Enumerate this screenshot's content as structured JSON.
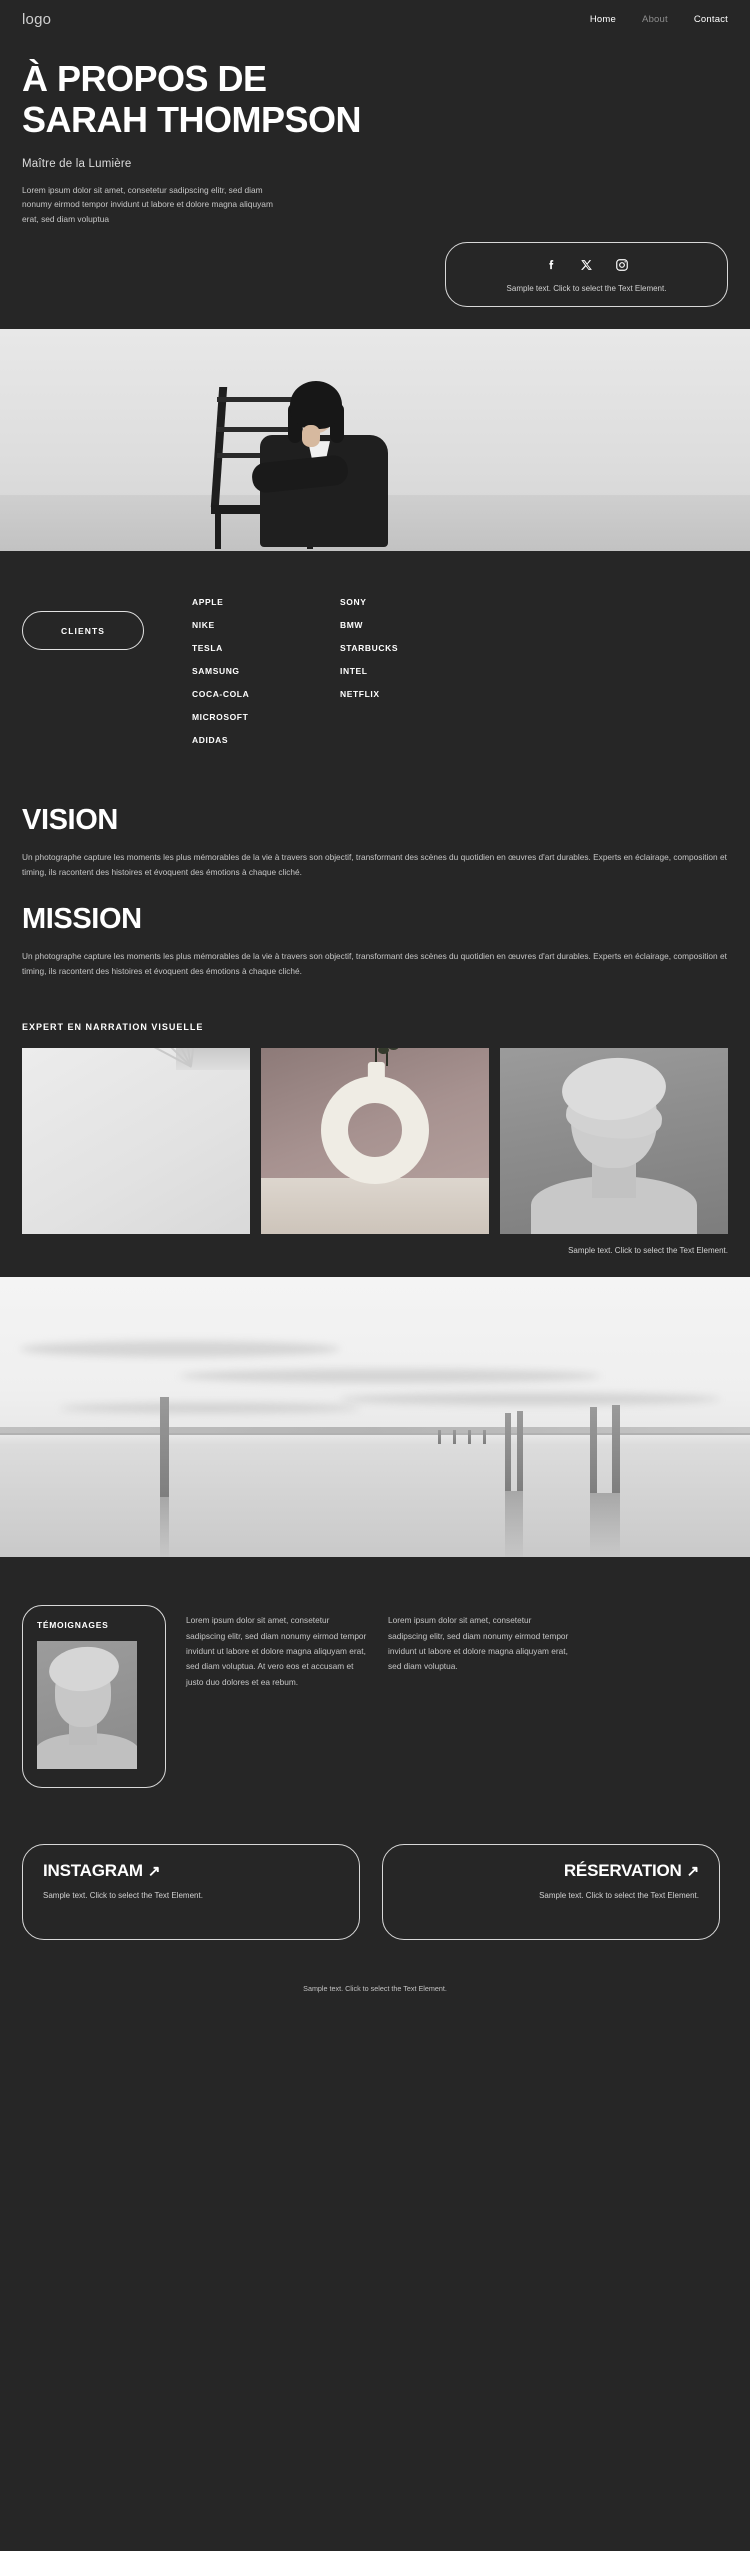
{
  "nav": {
    "logo": "logo",
    "links": [
      {
        "label": "Home",
        "muted": false
      },
      {
        "label": "About",
        "muted": true
      },
      {
        "label": "Contact",
        "muted": false
      }
    ]
  },
  "hero": {
    "title_line1": "À PROPOS DE",
    "title_line2": "SARAH THOMPSON",
    "subtitle": "Maître de la Lumière",
    "lead": "Lorem ipsum dolor sit amet, consetetur sadipscing elitr, sed diam nonumy eirmod tempor invidunt ut labore et dolore magna aliquyam erat, sed diam voluptua"
  },
  "social": {
    "icons": [
      "facebook-icon",
      "x-twitter-icon",
      "instagram-icon"
    ],
    "note": "Sample text. Click to select the Text Element."
  },
  "clients": {
    "pill_label": "CLIENTS",
    "column1": [
      "APPLE",
      "NIKE",
      "TESLA",
      "SAMSUNG",
      "COCA-COLA",
      "MICROSOFT",
      "ADIDAS"
    ],
    "column2": [
      "SONY",
      "BMW",
      "STARBUCKS",
      "INTEL",
      "NETFLIX"
    ]
  },
  "vision": {
    "heading": "VISION",
    "body": "Un photographe capture les moments les plus mémorables de la vie à travers son objectif, transformant des scènes du quotidien en œuvres d'art durables. Experts en éclairage, composition et timing, ils racontent des histoires et évoquent des émotions à chaque cliché."
  },
  "mission": {
    "heading": "MISSION",
    "body": "Un photographe capture les moments les plus mémorables de la vie à travers son objectif, transformant des scènes du quotidien en œuvres d'art durables. Experts en éclairage, composition et timing, ils racontent des histoires et évoquent des émotions à chaque cliché."
  },
  "gallery": {
    "heading": "EXPERT EN NARRATION VISUELLE",
    "images": [
      {
        "alt": "abstract-light-rays-photo"
      },
      {
        "alt": "ceramic-donut-vase-photo"
      },
      {
        "alt": "draped-sculpture-bust-photo"
      }
    ],
    "note": "Sample text. Click to select the Text Element."
  },
  "landscape": {
    "alt": "long-exposure-lake-posts-photo"
  },
  "testimonials": {
    "card_title": "TÉMOIGNAGES",
    "photo_alt": "draped-sculpture-portrait-photo",
    "columns": [
      "Lorem ipsum dolor sit amet, consetetur sadipscing elitr, sed diam nonumy eirmod tempor invidunt ut labore et dolore magna aliquyam erat, sed diam voluptua. At vero eos et accusam et justo duo dolores et ea rebum.",
      "Lorem ipsum dolor sit amet, consetetur sadipscing elitr, sed diam nonumy eirmod tempor invidunt ut labore et dolore magna aliquyam erat, sed diam voluptua."
    ]
  },
  "cta": {
    "instagram": {
      "title": "INSTAGRAM",
      "arrow": "↗",
      "note": "Sample text. Click to select the Text Element."
    },
    "reservation": {
      "title": "RÉSERVATION",
      "arrow": "↗",
      "note": "Sample text. Click to select the Text Element."
    }
  },
  "footer": {
    "note": "Sample text. Click to select the Text Element."
  },
  "colors": {
    "background": "#262626",
    "text": "#ffffff",
    "muted": "#c6c6c6",
    "border": "#d8d8d8"
  }
}
